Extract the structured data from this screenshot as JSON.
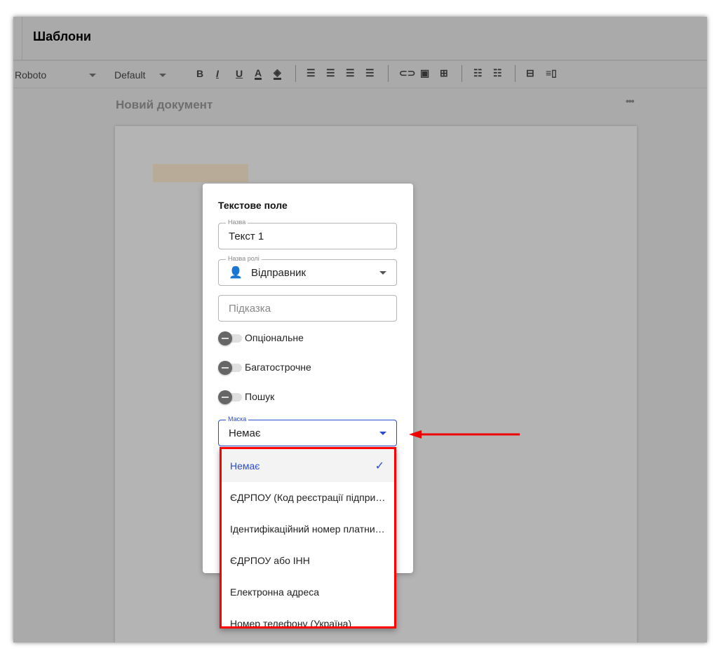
{
  "header": {
    "title": "Шаблони"
  },
  "toolbar": {
    "font": "Roboto",
    "size": "Default",
    "bold": "B",
    "italic": "I",
    "underline": "U",
    "text_color": "A"
  },
  "document": {
    "title": "Новий документ",
    "more": "•••"
  },
  "dialog": {
    "title": "Текстове поле",
    "name_label": "Назва",
    "name_value": "Текст 1",
    "role_label": "Назва ролі",
    "role_value": "Відправник",
    "hint_placeholder": "Підказка",
    "toggles": [
      "Опціональне",
      "Багатострочне",
      "Пошук"
    ],
    "mask_label": "Маска",
    "mask_value": "Немає"
  },
  "menu": {
    "items": [
      "Немає",
      "ЄДРПОУ (Код реєстрації підприємства)",
      "Ідентифікаційний номер платника податків",
      "ЄДРПОУ або ІНН",
      "Електронна адреса",
      "Номер телефону (Україна)"
    ],
    "selected": "Немає"
  },
  "colors": {
    "accent": "#2a4bd0",
    "highlight": "#ff0000"
  }
}
